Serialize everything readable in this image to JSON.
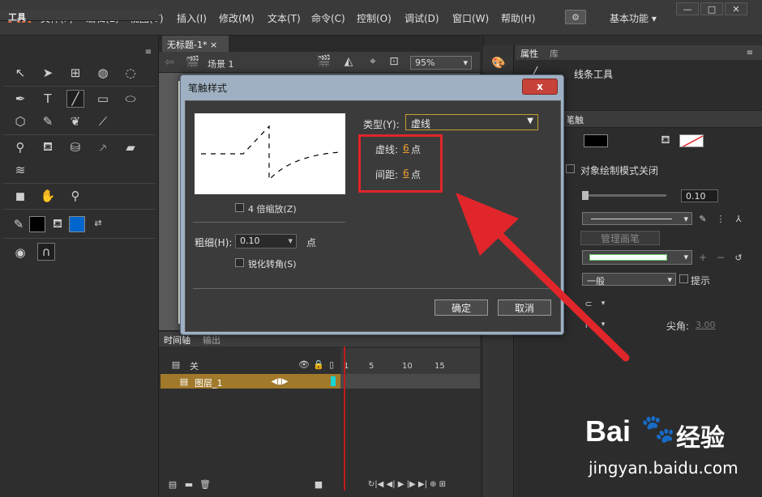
{
  "app": {
    "logo": "An",
    "menus": [
      "文件(F)",
      "编辑(E)",
      "视图(V)",
      "插入(I)",
      "修改(M)",
      "文本(T)",
      "命令(C)",
      "控制(O)",
      "调试(D)",
      "窗口(W)",
      "帮助(H)"
    ],
    "workspace": "基本功能"
  },
  "tools": {
    "title": "工具"
  },
  "document": {
    "tab": "无标题-1*",
    "scene": "场景 1",
    "zoom": "95%"
  },
  "timeline": {
    "tab": "时间轴",
    "tab2": "输出",
    "folder_label": "关",
    "layer": "图层_1",
    "ticks": [
      "1",
      "5",
      "10",
      "15"
    ]
  },
  "properties": {
    "tab": "属性",
    "tab2": "库",
    "tool_name": "线条工具",
    "section": "填充和笔触",
    "object_mode": "对象绘制模式关闭",
    "stroke_value": "0.10",
    "manage_brush": "管理画笔",
    "scale": "一般",
    "hint": "提示",
    "miter_label": "尖角:",
    "miter_value": "3.00"
  },
  "dialog": {
    "title": "笔触样式",
    "close": "x",
    "zoom_check": "4 倍缩放(Z)",
    "thickness_label": "粗细(H):",
    "thickness_value": "0.10",
    "thickness_unit": "点",
    "sharpen_check": "锐化转角(S)",
    "type_label": "类型(Y):",
    "type_value": "虚线",
    "dash_label": "虚线:",
    "dash_value": "6",
    "dash_unit": "点",
    "gap_label": "间距:",
    "gap_value": "6",
    "gap_unit": "点",
    "ok": "确定",
    "cancel": "取消"
  },
  "watermark": {
    "brand": "Bai",
    "brand2": "经验",
    "url": "jingyan.baidu.com"
  },
  "colors": {
    "accent": "#e0262a",
    "layer": "#a0792a",
    "dialog_frame": "#9fb0c2"
  }
}
